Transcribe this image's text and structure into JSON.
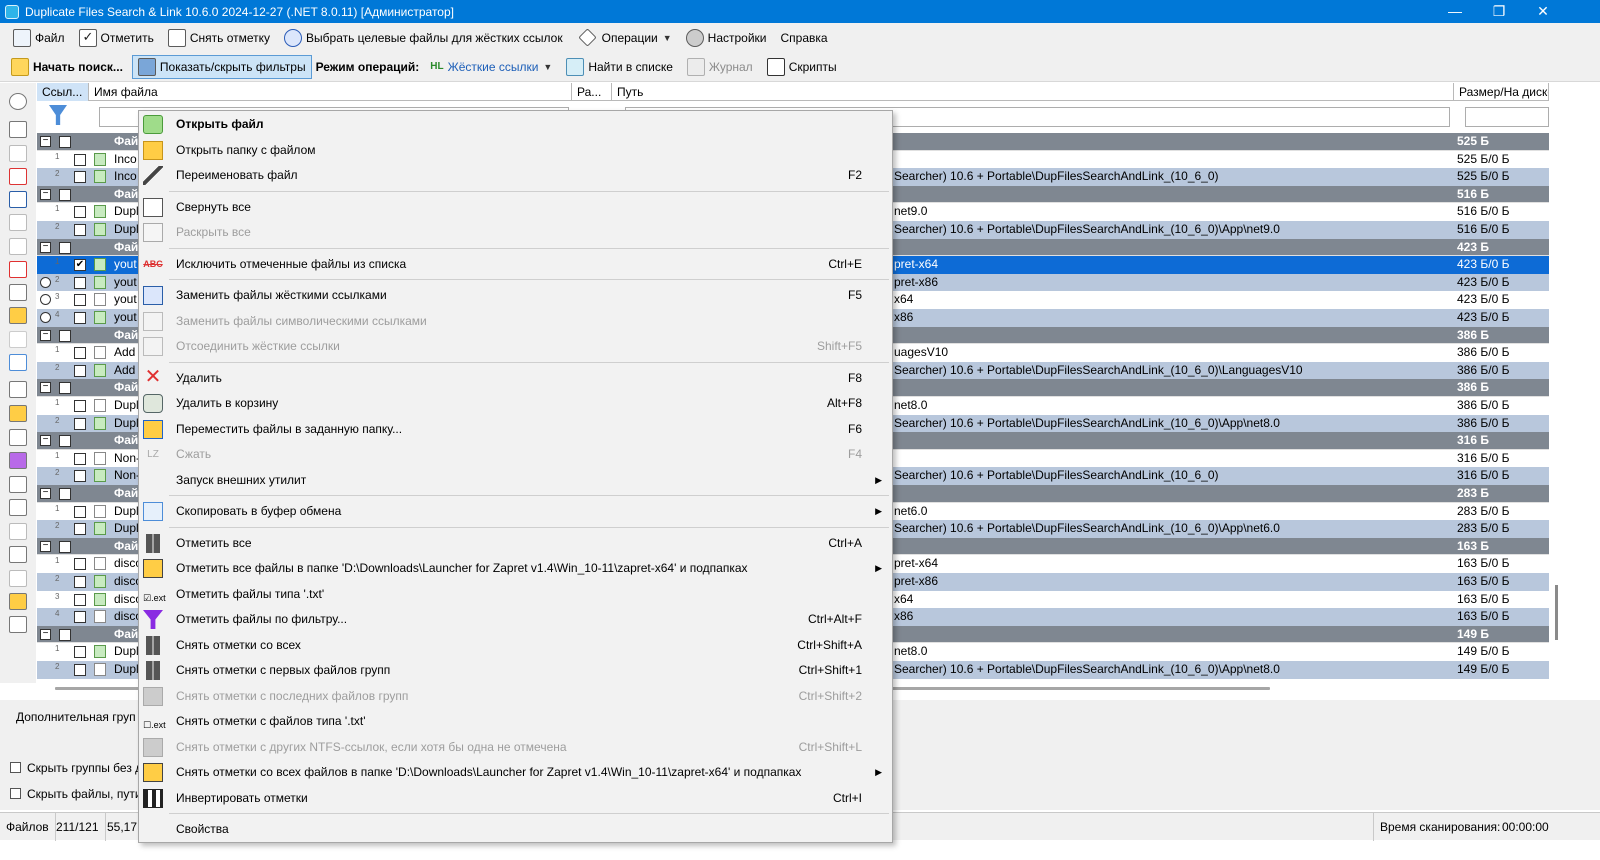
{
  "window": {
    "title": "Duplicate Files Search & Link 10.6.0 2024-12-27 (.NET 8.0.11) [Администратор]",
    "minimize": "—",
    "maximize": "❐",
    "close": "✕"
  },
  "menubar": {
    "file": "Файл",
    "mark": "Отметить",
    "unmark": "Снять отметку",
    "select_targets": "Выбрать целевые файлы для жёстких ссылок",
    "operations": "Операции",
    "settings": "Настройки",
    "help": "Справка"
  },
  "toolbar": {
    "start_search": "Начать поиск...",
    "toggle_filters": "Показать/скрыть фильтры",
    "mode_label": "Режим операций:",
    "mode_value": "Жёсткие ссылки",
    "mode_prefix": "HL",
    "find_in_list": "Найти в списке",
    "journal": "Журнал",
    "scripts": "Скрипты"
  },
  "columns": {
    "links": "Ссыл...",
    "filename": "Имя файла",
    "ext": "Ра...",
    "path": "Путь",
    "size": "Размер/На диске"
  },
  "rows": [
    {
      "type": "g",
      "name": "Фай",
      "size": "525 Б"
    },
    {
      "type": "e",
      "num": "1",
      "name": "Inco",
      "path": "",
      "size": "525 Б/0 Б"
    },
    {
      "type": "o",
      "num": "2",
      "name": "Inco",
      "path": "Searcher) 10.6 + Portable\\DupFilesSearchAndLink_(10_6_0)",
      "size": "525 Б/0 Б"
    },
    {
      "type": "g",
      "name": "Фай",
      "size": "516 Б"
    },
    {
      "type": "e",
      "num": "1",
      "name": "Dupl",
      "path": "net9.0",
      "size": "516 Б/0 Б"
    },
    {
      "type": "o",
      "num": "2",
      "name": "Dupl",
      "path": "Searcher) 10.6 + Portable\\DupFilesSearchAndLink_(10_6_0)\\App\\net9.0",
      "size": "516 Б/0 Б"
    },
    {
      "type": "g",
      "name": "Фай",
      "size": "423 Б"
    },
    {
      "type": "s",
      "num": "1",
      "name": "yout",
      "path": "pret-x64",
      "size": "423 Б/0 Б",
      "checked": "✔"
    },
    {
      "type": "o",
      "num": "2",
      "name": "yout",
      "path": "pret-x86",
      "size": "423 Б/0 Б",
      "radio": true
    },
    {
      "type": "e",
      "num": "3",
      "name": "yout",
      "path": "x64",
      "size": "423 Б/0 Б",
      "radio": true
    },
    {
      "type": "o",
      "num": "4",
      "name": "yout",
      "path": "x86",
      "size": "423 Б/0 Б",
      "radio": true
    },
    {
      "type": "g",
      "name": "Фай",
      "size": "386 Б"
    },
    {
      "type": "e",
      "num": "1",
      "name": "Add",
      "path": "uagesV10",
      "size": "386 Б/0 Б"
    },
    {
      "type": "o",
      "num": "2",
      "name": "Add",
      "path": "Searcher) 10.6 + Portable\\DupFilesSearchAndLink_(10_6_0)\\LanguagesV10",
      "size": "386 Б/0 Б"
    },
    {
      "type": "g",
      "name": "Фай",
      "size": "386 Б"
    },
    {
      "type": "e",
      "num": "1",
      "name": "Dupl",
      "path": "net8.0",
      "size": "386 Б/0 Б"
    },
    {
      "type": "o",
      "num": "2",
      "name": "Dupl",
      "path": "Searcher) 10.6 + Portable\\DupFilesSearchAndLink_(10_6_0)\\App\\net8.0",
      "size": "386 Б/0 Б"
    },
    {
      "type": "g",
      "name": "Фай",
      "size": "316 Б"
    },
    {
      "type": "e",
      "num": "1",
      "name": "Non-",
      "path": "",
      "size": "316 Б/0 Б"
    },
    {
      "type": "o",
      "num": "2",
      "name": "Non-",
      "path": "Searcher) 10.6 + Portable\\DupFilesSearchAndLink_(10_6_0)",
      "size": "316 Б/0 Б"
    },
    {
      "type": "g",
      "name": "Фай",
      "size": "283 Б"
    },
    {
      "type": "e",
      "num": "1",
      "name": "Dupl",
      "path": "net6.0",
      "size": "283 Б/0 Б"
    },
    {
      "type": "o",
      "num": "2",
      "name": "Dupl",
      "path": "Searcher) 10.6 + Portable\\DupFilesSearchAndLink_(10_6_0)\\App\\net6.0",
      "size": "283 Б/0 Б"
    },
    {
      "type": "g",
      "name": "Фай",
      "size": "163 Б"
    },
    {
      "type": "e",
      "num": "1",
      "name": "disco",
      "path": "pret-x64",
      "size": "163 Б/0 Б"
    },
    {
      "type": "o",
      "num": "2",
      "name": "disco",
      "path": "pret-x86",
      "size": "163 Б/0 Б"
    },
    {
      "type": "e",
      "num": "3",
      "name": "disco",
      "path": "x64",
      "size": "163 Б/0 Б"
    },
    {
      "type": "o",
      "num": "4",
      "name": "disco",
      "path": "x86",
      "size": "163 Б/0 Б"
    },
    {
      "type": "g",
      "name": "Фай",
      "size": "149 Б"
    },
    {
      "type": "e",
      "num": "1",
      "name": "Dupl",
      "path": "net8.0",
      "size": "149 Б/0 Б"
    },
    {
      "type": "o",
      "num": "2",
      "name": "Dupl",
      "path": "Searcher) 10.6 + Portable\\DupFilesSearchAndLink_(10_6_0)\\App\\net8.0",
      "size": "149 Б/0 Б"
    }
  ],
  "bottom": {
    "extra_groups": "Дополнительная груп",
    "hide_groups": "Скрыть группы без д",
    "hide_files": "Скрыть файлы, пути"
  },
  "status": {
    "files_label": "Файлов",
    "files_count": "211/121",
    "size": "55,17",
    "scan_time_label": "Время сканирования:",
    "scan_time": "00:00:00"
  },
  "context_menu": {
    "items": [
      {
        "label": "Открыть файл",
        "key": "",
        "icon": "open-file-icon",
        "ico": "ogreen",
        "bold": true
      },
      {
        "label": "Открыть папку с файлом",
        "key": "",
        "icon": "folder-icon",
        "ico": "ofold"
      },
      {
        "label": "Переименовать файл",
        "key": "F2",
        "icon": "pencil-icon",
        "ico": "pencil"
      },
      {
        "sep": true
      },
      {
        "label": "Свернуть все",
        "key": "",
        "icon": "collapse-all-icon",
        "ico": "coll"
      },
      {
        "label": "Раскрыть все",
        "key": "",
        "icon": "expand-all-icon",
        "ico": "exp2",
        "disabled": true
      },
      {
        "sep": true
      },
      {
        "label": "Исключить отмеченные файлы из списка",
        "key": "Ctrl+E",
        "icon": "exclude-icon",
        "ico": "abc",
        "glyph": "ABC"
      },
      {
        "sep": true
      },
      {
        "label": "Заменить файлы жёсткими ссылками",
        "key": "F5",
        "icon": "hardlink-icon",
        "ico": "hlnk"
      },
      {
        "label": "Заменить файлы символическими ссылками",
        "key": "",
        "icon": "symlink-icon",
        "ico": "sym",
        "disabled": true
      },
      {
        "label": "Отсоединить жёсткие ссылки",
        "key": "Shift+F5",
        "icon": "unlink-icon",
        "ico": "sym",
        "disabled": true
      },
      {
        "sep": true
      },
      {
        "label": "Удалить",
        "key": "F8",
        "icon": "delete-icon",
        "ico": "xred",
        "glyph": "✕"
      },
      {
        "label": "Удалить в корзину",
        "key": "Alt+F8",
        "icon": "recycle-bin-icon",
        "ico": "bin"
      },
      {
        "label": "Переместить файлы в заданную папку...",
        "key": "F6",
        "icon": "move-folder-icon",
        "ico": "move"
      },
      {
        "label": "Сжать",
        "key": "F4",
        "icon": "compress-icon",
        "ico": "lz",
        "glyph": "LZ",
        "disabled": true
      },
      {
        "label": "Запуск внешних утилит",
        "key": "",
        "icon": "",
        "ico": "",
        "arrow": "▶"
      },
      {
        "sep": true
      },
      {
        "label": "Скопировать в буфер обмена",
        "key": "",
        "icon": "clipboard-copy-icon",
        "ico": "copy",
        "arrow": "▶"
      },
      {
        "sep": true
      },
      {
        "label": "Отметить все",
        "key": "Ctrl+A",
        "icon": "mark-all-icon",
        "ico": "bars"
      },
      {
        "label": "Отметить все файлы в папке 'D:\\Downloads\\Launcher for Zapret v1.4\\Win_10-11\\zapret-x64' и подпапках",
        "key": "",
        "icon": "mark-folder-icon",
        "ico": "foldchk",
        "arrow": "▶"
      },
      {
        "label": "Отметить файлы типа '.txt'",
        "key": "",
        "icon": "mark-ext-icon",
        "ico": "ext",
        "glyph": "☑.ext"
      },
      {
        "label": "Отметить файлы по фильтру...",
        "key": "Ctrl+Alt+F",
        "icon": "filter-icon",
        "ico": "funnel"
      },
      {
        "label": "Снять отметки со всех",
        "key": "Ctrl+Shift+A",
        "icon": "unmark-all-icon",
        "ico": "bars"
      },
      {
        "label": "Снять отметки с первых файлов групп",
        "key": "Ctrl+Shift+1",
        "icon": "unmark-first-icon",
        "ico": "bars"
      },
      {
        "label": "Снять отметки с последних файлов групп",
        "key": "Ctrl+Shift+2",
        "icon": "unmark-last-icon",
        "ico": "grayb",
        "disabled": true
      },
      {
        "label": "Снять отметки с файлов типа '.txt'",
        "key": "",
        "icon": "unmark-ext-icon",
        "ico": "ext",
        "glyph": "☐.ext"
      },
      {
        "label": "Снять отметки с других NTFS-ссылок, если хотя бы одна не отмечена",
        "key": "Ctrl+Shift+L",
        "icon": "unmark-ntfs-icon",
        "ico": "grayb",
        "disabled": true
      },
      {
        "label": "Снять отметки со всех файлов в папке 'D:\\Downloads\\Launcher for Zapret v1.4\\Win_10-11\\zapret-x64' и подпапках",
        "key": "",
        "icon": "unmark-folder-icon",
        "ico": "foldchk",
        "arrow": "▶"
      },
      {
        "label": "Инвертировать отметки",
        "key": "Ctrl+I",
        "icon": "invert-icon",
        "ico": "inv"
      },
      {
        "sep": true
      },
      {
        "label": "Свойства",
        "key": "",
        "icon": "",
        "ico": ""
      }
    ]
  }
}
